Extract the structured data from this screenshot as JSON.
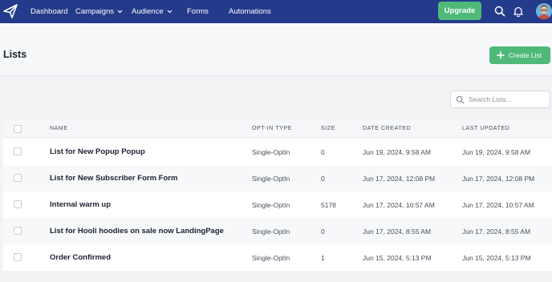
{
  "nav": {
    "items": [
      {
        "label": "Dashboard",
        "has_menu": false
      },
      {
        "label": "Campaigns",
        "has_menu": true
      },
      {
        "label": "Audience",
        "has_menu": true
      },
      {
        "label": "Forms",
        "has_menu": false
      },
      {
        "label": "Automations",
        "has_menu": false
      }
    ],
    "upgrade_label": "Upgrade",
    "icons": [
      "paper-plane-logo-icon",
      "search-icon",
      "bell-icon",
      "user-avatar"
    ]
  },
  "page": {
    "title": "Lists",
    "create_label": "Create List",
    "search_placeholder": "Search Lists..."
  },
  "table": {
    "columns": [
      "NAME",
      "OPT-IN TYPE",
      "SIZE",
      "DATE CREATED",
      "LAST UPDATED"
    ],
    "rows": [
      {
        "name": "List for New Popup Popup",
        "optin": "Single-OptIn",
        "size": "0",
        "created": "Jun 19, 2024, 9:58 AM",
        "updated": "Jun 19, 2024, 9:58 AM"
      },
      {
        "name": "List for New Subscriber Form Form",
        "optin": "Single-OptIn",
        "size": "0",
        "created": "Jun 17, 2024, 12:08 PM",
        "updated": "Jun 17, 2024, 12:08 PM"
      },
      {
        "name": "Internal warm up",
        "optin": "Single-OptIn",
        "size": "5178",
        "created": "Jun 17, 2024, 10:57 AM",
        "updated": "Jun 17, 2024, 10:57 AM"
      },
      {
        "name": "List for Hooli hoodies on sale now LandingPage",
        "optin": "Single-OptIn",
        "size": "0",
        "created": "Jun 17, 2024, 8:55 AM",
        "updated": "Jun 17, 2024, 8:55 AM"
      },
      {
        "name": "Order Confirmed",
        "optin": "Single-OptIn",
        "size": "1",
        "created": "Jun 15, 2024, 5:13 PM",
        "updated": "Jun 15, 2024, 5:13 PM"
      }
    ]
  },
  "colors": {
    "nav_bg": "#243a8a",
    "accent_green": "#4fb97a",
    "page_bg": "#f2f3f5"
  }
}
